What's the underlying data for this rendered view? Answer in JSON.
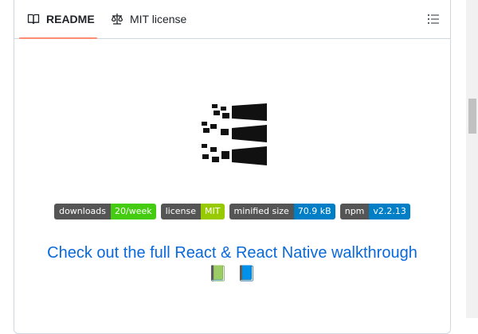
{
  "tabs": [
    {
      "label": "README",
      "icon": "book-icon",
      "active": true
    },
    {
      "label": "MIT license",
      "icon": "law-icon",
      "active": false
    }
  ],
  "toc_icon": "list-unordered-icon",
  "logo": {
    "name": "stacked-bars-logo"
  },
  "badges": [
    {
      "label": "downloads",
      "value": "20/week",
      "color": "#4c1"
    },
    {
      "label": "license",
      "value": "MIT",
      "color": "#97ca00"
    },
    {
      "label": "minified size",
      "value": "70.9 kB",
      "color": "#007ec6"
    },
    {
      "label": "npm",
      "value": "v2.2.13",
      "color": "#007ec6"
    }
  ],
  "walkthrough_link": "Check out the full React & React Native walkthrough",
  "books": [
    "📗",
    "📘"
  ],
  "colors": {
    "accent_underline": "#fd8c73",
    "link": "#0969da"
  }
}
